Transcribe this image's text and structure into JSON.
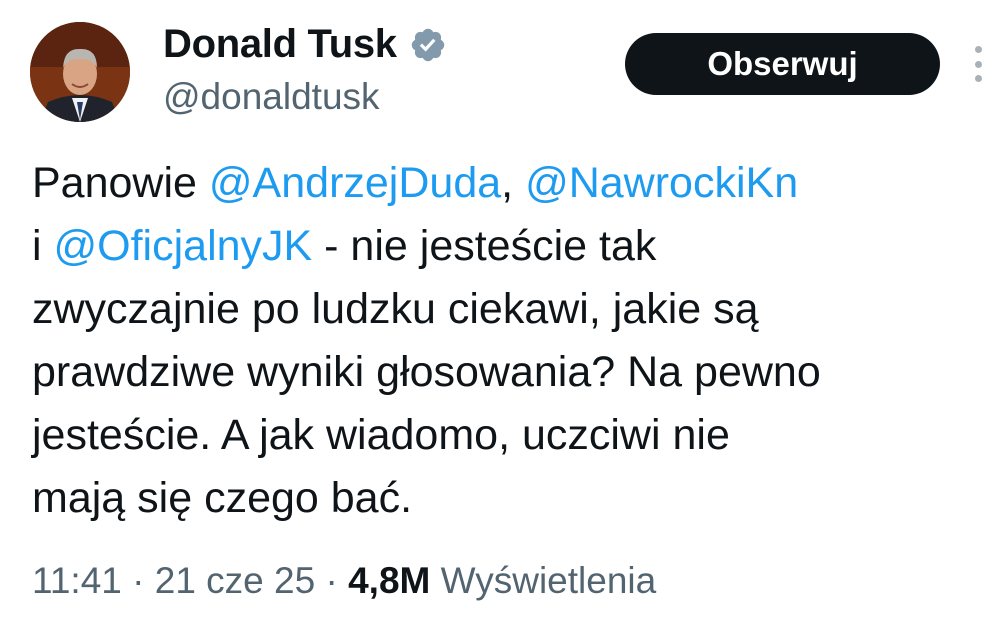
{
  "author": {
    "display_name": "Donald Tusk",
    "handle": "@donaldtusk",
    "verified_icon": "verified-badge-icon"
  },
  "actions": {
    "follow_label": "Obserwuj",
    "more_icon": "more-vertical-icon"
  },
  "tweet": {
    "line1_prefix": "Panowie ",
    "mention1": "@AndrzejDuda",
    "line1_sep": ", ",
    "mention2": "@NawrockiKn",
    "line2_prefix": "i ",
    "mention3": "@OficjalnyJK",
    "line2_suffix": " - nie jesteście tak",
    "line3": "zwyczajnie po ludzku ciekawi, jakie są",
    "line4": "prawdziwe wyniki głosowania? Na pewno",
    "line5": "jesteście. A jak wiadomo, uczciwi nie",
    "line6": "mają się czego bać."
  },
  "meta": {
    "time": "11:41",
    "separator": " · ",
    "date": "21 cze 25",
    "views_count": "4,8M",
    "views_label": "Wyświetlenia"
  },
  "colors": {
    "text": "#0f1419",
    "secondary": "#536471",
    "link": "#1d9bf0",
    "button_bg": "#0f1419",
    "verified_badge": "#829aab"
  }
}
